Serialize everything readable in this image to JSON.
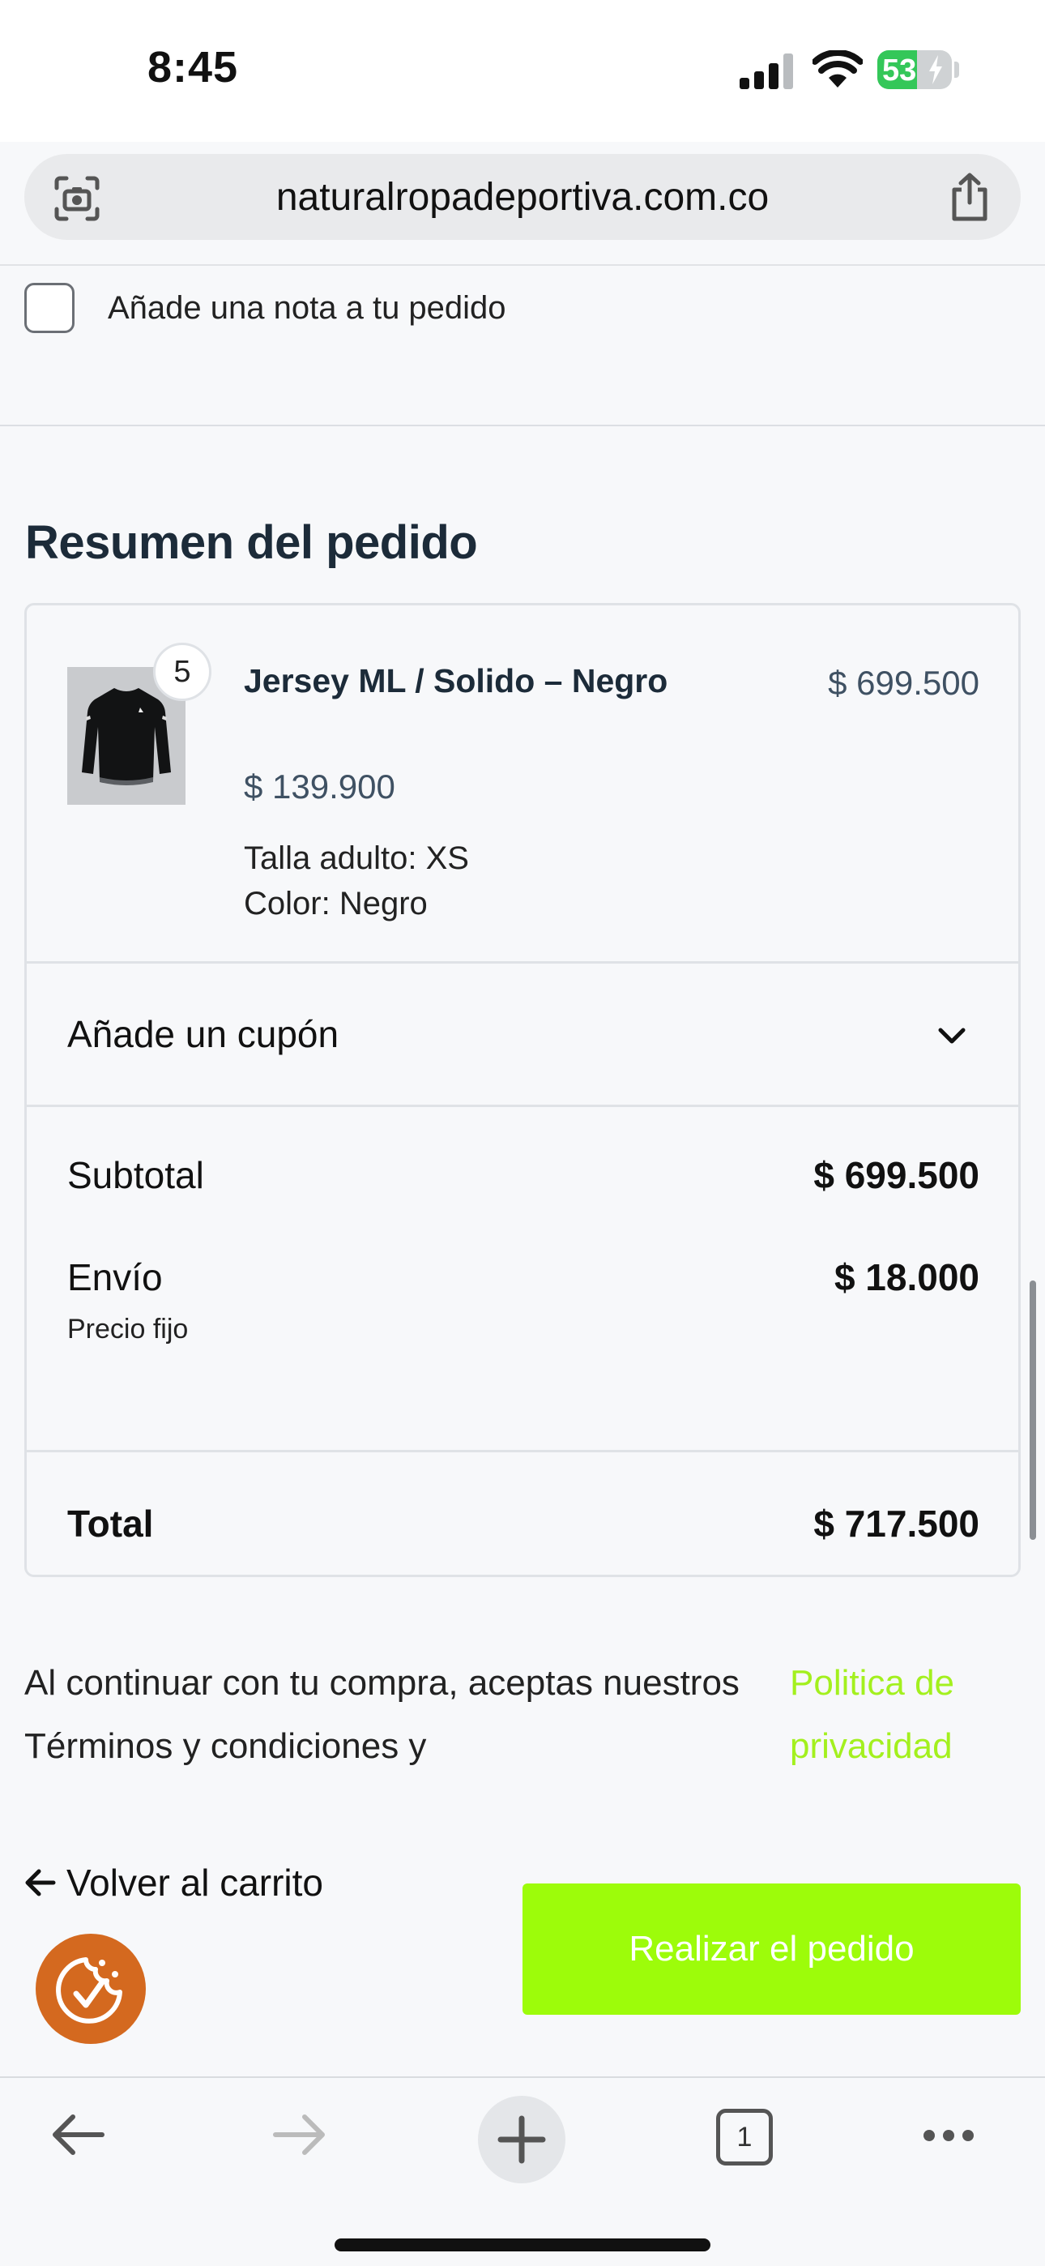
{
  "status": {
    "time": "8:45",
    "battery": "53"
  },
  "browser": {
    "url": "naturalropadeportiva.com.co"
  },
  "note": {
    "label": "Añade una nota a tu pedido"
  },
  "summary": {
    "title": "Resumen del pedido",
    "item": {
      "quantity": "5",
      "name": "Jersey ML / Solido – Negro",
      "total": "$ 699.500",
      "unit_price": "$ 139.900",
      "size": "Talla adulto: XS",
      "color": "Color: Negro"
    },
    "coupon_label": "Añade un cupón",
    "subtotal_label": "Subtotal",
    "subtotal_value": "$ 699.500",
    "shipping_label": "Envío",
    "shipping_value": "$ 18.000",
    "shipping_method": "Precio fijo",
    "total_label": "Total",
    "total_value": "$ 717.500"
  },
  "legal": {
    "text": "Al continuar con tu compra, aceptas nuestros Términos y condiciones y",
    "policy_link": "Politica de privacidad"
  },
  "actions": {
    "back_label": "Volver al carrito",
    "place_order_label": "Realizar el pedido"
  },
  "toolbar": {
    "tab_count": "1"
  },
  "colors": {
    "accent_green": "#9dfc0a",
    "policy_link": "#a3f01e",
    "heading": "#1c2b39",
    "cookie_button": "#d4691f"
  },
  "icons": [
    "camera-lens-icon",
    "share-icon",
    "chevron-down-icon",
    "arrow-left-icon",
    "cookie-check-icon",
    "back-icon",
    "forward-icon",
    "plus-icon",
    "tabs-icon",
    "more-icon"
  ]
}
